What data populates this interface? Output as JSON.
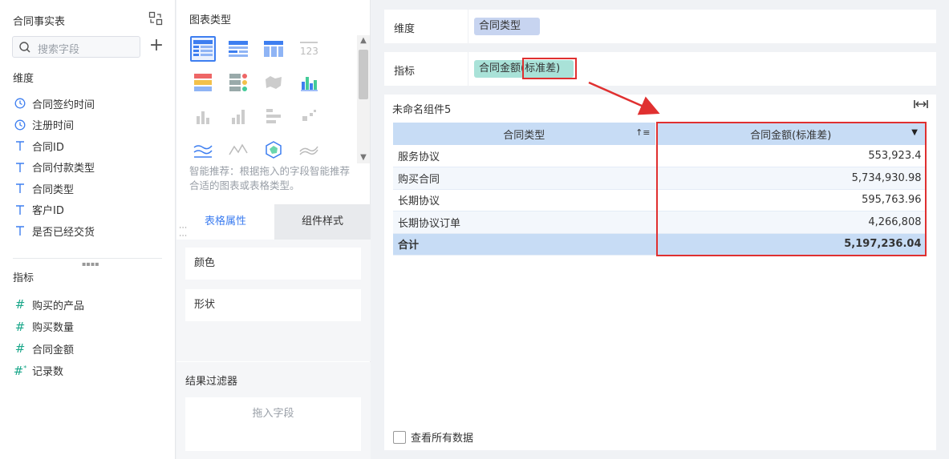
{
  "left": {
    "title": "合同事实表",
    "search_placeholder": "搜索字段",
    "dimensions_label": "维度",
    "dimensions": [
      {
        "icon": "clock-icon",
        "label": "合同签约时间"
      },
      {
        "icon": "clock-icon",
        "label": "注册时间"
      },
      {
        "icon": "text-t-icon",
        "label": "合同ID"
      },
      {
        "icon": "text-t-icon",
        "label": "合同付款类型"
      },
      {
        "icon": "text-t-icon",
        "label": "合同类型"
      },
      {
        "icon": "text-t-icon",
        "label": "客户ID"
      },
      {
        "icon": "text-t-icon",
        "label": "是否已经交货"
      }
    ],
    "metrics_label": "指标",
    "metrics": [
      {
        "icon": "hash-icon",
        "label": "购买的产品"
      },
      {
        "icon": "hash-icon",
        "label": "购买数量"
      },
      {
        "icon": "hash-icon",
        "label": "合同金额"
      },
      {
        "icon": "hash-star-icon",
        "label": "记录数"
      }
    ]
  },
  "middle": {
    "chart_type_label": "图表类型",
    "hint": "智能推荐：根据拖入的字段智能推荐合适的图表或表格类型。",
    "tabs": {
      "table_props": "表格属性",
      "component_style": "组件样式"
    },
    "props": {
      "color": "颜色",
      "shape": "形状"
    },
    "filter": {
      "title": "结果过滤器",
      "drop_hint": "拖入字段"
    }
  },
  "right": {
    "dimension_bar": {
      "label": "维度",
      "pill": "合同类型"
    },
    "metric_bar": {
      "label": "指标",
      "pill_prefix": "合同金额",
      "pill_suffix": "(标准差)"
    },
    "component": {
      "title": "未命名组件5",
      "columns": [
        "合同类型",
        "合同金额(标准差)"
      ],
      "rows": [
        {
          "type": "服务协议",
          "value": "553,923.4"
        },
        {
          "type": "购买合同",
          "value": "5,734,930.98"
        },
        {
          "type": "长期协议",
          "value": "595,763.96"
        },
        {
          "type": "长期协议订单",
          "value": "4,266,808"
        }
      ],
      "total": {
        "label": "合计",
        "value": "5,197,236.04"
      },
      "view_all": "查看所有数据"
    }
  },
  "colors": {
    "accent": "#3d7ef0",
    "highlight_red": "#e03030",
    "header_blue": "#c7dcf5"
  }
}
